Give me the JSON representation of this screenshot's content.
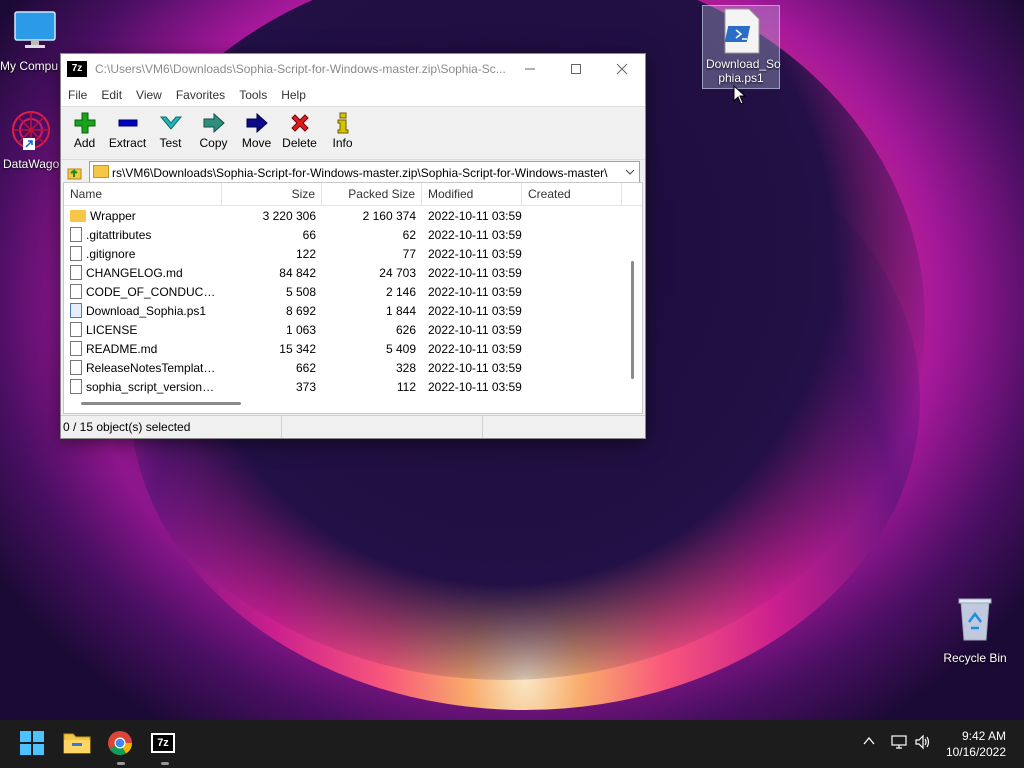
{
  "desktop": {
    "icons": [
      {
        "label": "My Compu"
      },
      {
        "label": "DataWago"
      },
      {
        "label": "Download_So phia.ps1"
      },
      {
        "label": "Recycle Bin"
      }
    ]
  },
  "window": {
    "title": "C:\\Users\\VM6\\Downloads\\Sophia-Script-for-Windows-master.zip\\Sophia-Sc...",
    "app_icon": "7z",
    "menu": [
      "File",
      "Edit",
      "View",
      "Favorites",
      "Tools",
      "Help"
    ],
    "toolbar": [
      {
        "label": "Add",
        "icon": "plus-icon",
        "color": "#19a319"
      },
      {
        "label": "Extract",
        "icon": "minus-icon",
        "color": "#0000c8"
      },
      {
        "label": "Test",
        "icon": "check-icon",
        "color": "#25b5b5"
      },
      {
        "label": "Copy",
        "icon": "arrow-right-icon",
        "color": "#2f8f7f"
      },
      {
        "label": "Move",
        "icon": "arrow-right-icon",
        "color": "#0a0a8a"
      },
      {
        "label": "Delete",
        "icon": "x-icon",
        "color": "#d81e1e"
      },
      {
        "label": "Info",
        "icon": "info-icon",
        "color": "#d8c300"
      }
    ],
    "address": "rs\\VM6\\Downloads\\Sophia-Script-for-Windows-master.zip\\Sophia-Script-for-Windows-master\\",
    "columns": [
      "Name",
      "Size",
      "Packed Size",
      "Modified",
      "Created"
    ],
    "rows": [
      {
        "name": "Wrapper",
        "size": "3 220 306",
        "packed": "2 160 374",
        "modified": "2022-10-11 03:59",
        "created": "",
        "type": "folder"
      },
      {
        "name": ".gitattributes",
        "size": "66",
        "packed": "62",
        "modified": "2022-10-11 03:59",
        "created": "",
        "type": "file"
      },
      {
        "name": ".gitignore",
        "size": "122",
        "packed": "77",
        "modified": "2022-10-11 03:59",
        "created": "",
        "type": "file"
      },
      {
        "name": "CHANGELOG.md",
        "size": "84 842",
        "packed": "24 703",
        "modified": "2022-10-11 03:59",
        "created": "",
        "type": "file"
      },
      {
        "name": "CODE_OF_CONDUCT.md",
        "size": "5 508",
        "packed": "2 146",
        "modified": "2022-10-11 03:59",
        "created": "",
        "type": "file"
      },
      {
        "name": "Download_Sophia.ps1",
        "size": "8 692",
        "packed": "1 844",
        "modified": "2022-10-11 03:59",
        "created": "",
        "type": "script"
      },
      {
        "name": "LICENSE",
        "size": "1 063",
        "packed": "626",
        "modified": "2022-10-11 03:59",
        "created": "",
        "type": "file"
      },
      {
        "name": "README.md",
        "size": "15 342",
        "packed": "5 409",
        "modified": "2022-10-11 03:59",
        "created": "",
        "type": "file"
      },
      {
        "name": "ReleaseNotesTemplate....",
        "size": "662",
        "packed": "328",
        "modified": "2022-10-11 03:59",
        "created": "",
        "type": "file"
      },
      {
        "name": "sophia_script_versions.j...",
        "size": "373",
        "packed": "112",
        "modified": "2022-10-11 03:59",
        "created": "",
        "type": "file"
      }
    ],
    "status": "0 / 15 object(s) selected"
  },
  "taskbar": {
    "time": "9:42 AM",
    "date": "10/16/2022",
    "seven_zip_label": "7z"
  }
}
